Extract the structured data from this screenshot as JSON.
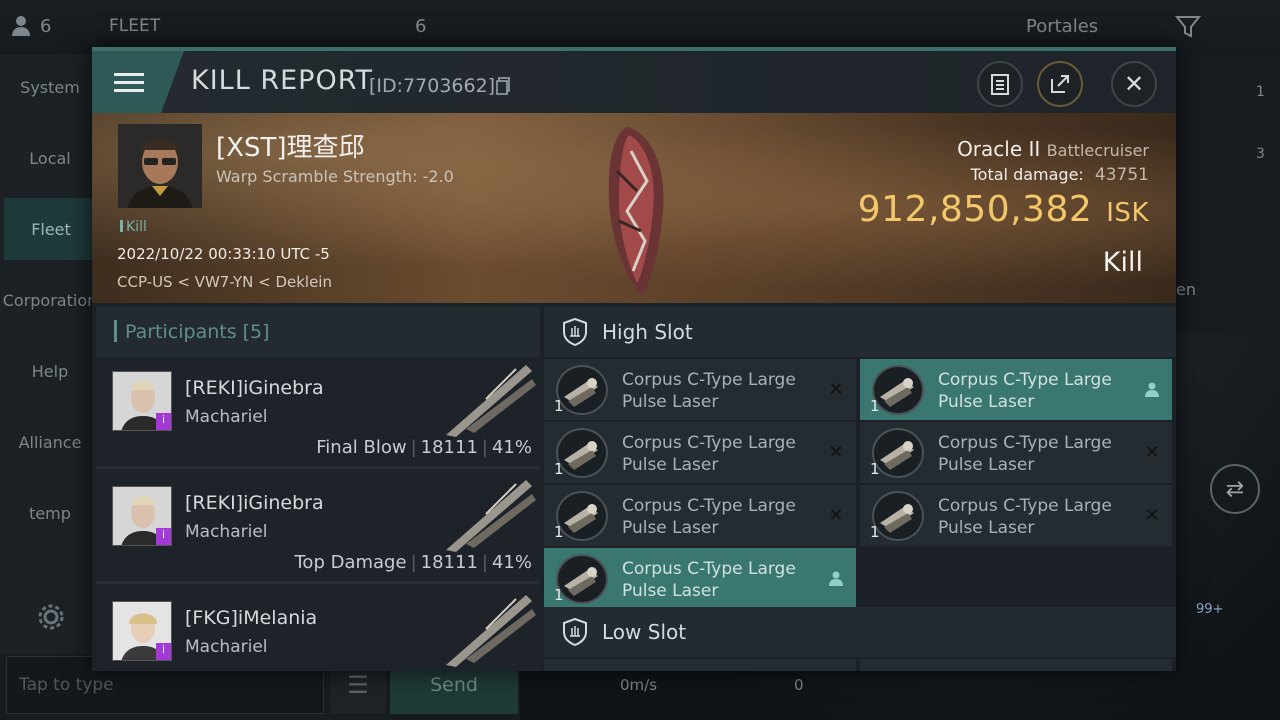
{
  "background": {
    "fleet_count": "6",
    "fleet_title": "FLEET",
    "fleet_badge": "6",
    "portales_label": "Portales",
    "nav_items": [
      "System",
      "Local",
      "Fleet",
      "Corporation",
      "Help",
      "Alliance",
      "temp"
    ],
    "chat_placeholder": "Tap to type",
    "send_label": "Send",
    "speed": "0m/s",
    "speed_value": "0",
    "right_counts": [
      "1",
      "3"
    ],
    "right_badge": "99+",
    "right_text": "en"
  },
  "report": {
    "title": "KILL REPORT",
    "id": "[ID:7703662]",
    "pilot_name": "[XST]理查邱",
    "scramble": "Warp Scramble Strength: -2.0",
    "kill_tag": "Kill",
    "datetime": "2022/10/22 00:33:10 UTC -5",
    "location": "CCP-US < VW7-YN < Deklein",
    "ship": "Oracle II",
    "ship_class": "Battlecruiser",
    "total_damage_label": "Total damage:",
    "total_damage": "43751",
    "isk_value": "912,850,382",
    "isk_unit": "ISK",
    "result": "Kill"
  },
  "participants": {
    "header": "Participants [5]",
    "rows": [
      {
        "name": "[REKI]iGinebra",
        "ship": "Machariel",
        "role": "Final Blow",
        "damage": "18111",
        "percent": "41%"
      },
      {
        "name": "[REKI]iGinebra",
        "ship": "Machariel",
        "role": "Top Damage",
        "damage": "18111",
        "percent": "41%"
      },
      {
        "name": "[FKG]iMelania",
        "ship": "Machariel",
        "role": "",
        "damage": "",
        "percent": ""
      }
    ]
  },
  "slots": {
    "high_title": "High Slot",
    "low_title": "Low Slot",
    "high_modules": [
      {
        "name_line1": "Corpus C-Type Large",
        "name_line2": "Pulse Laser",
        "qty": "1",
        "state": "destroyed"
      },
      {
        "name_line1": "Corpus C-Type Large",
        "name_line2": "Pulse Laser",
        "qty": "1",
        "state": "dropped"
      },
      {
        "name_line1": "Corpus C-Type Large",
        "name_line2": "Pulse Laser",
        "qty": "1",
        "state": "destroyed"
      },
      {
        "name_line1": "Corpus C-Type Large",
        "name_line2": "Pulse Laser",
        "qty": "1",
        "state": "destroyed"
      },
      {
        "name_line1": "Corpus C-Type Large",
        "name_line2": "Pulse Laser",
        "qty": "1",
        "state": "destroyed"
      },
      {
        "name_line1": "Corpus C-Type Large",
        "name_line2": "Pulse Laser",
        "qty": "1",
        "state": "destroyed"
      },
      {
        "name_line1": "Corpus C-Type Large",
        "name_line2": "Pulse Laser",
        "qty": "1",
        "state": "dropped"
      }
    ]
  },
  "colors": {
    "accent": "#3a7770",
    "isk": "#f3c76a",
    "header_teal": "#2f5956"
  }
}
